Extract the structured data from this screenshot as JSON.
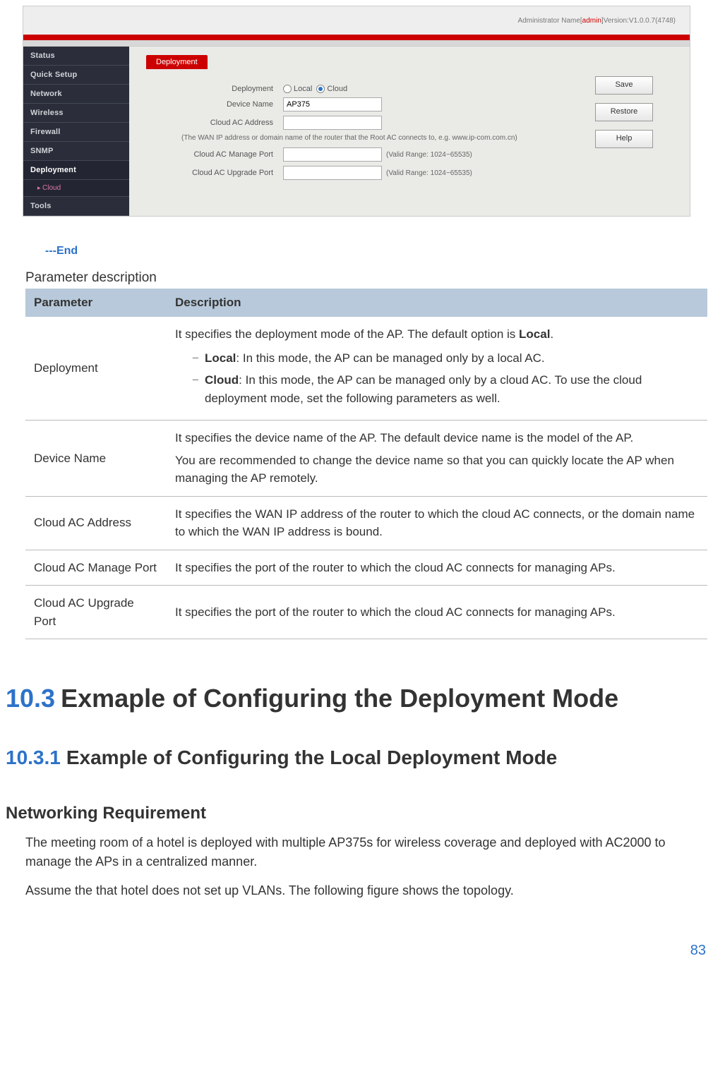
{
  "screenshot": {
    "topbar": {
      "admin_prefix": "Administrator Name[",
      "admin_user": "admin",
      "admin_suffix": "]Version:V1.0.0.7(4748)"
    },
    "sidebar": {
      "items": [
        "Status",
        "Quick Setup",
        "Network",
        "Wireless",
        "Firewall",
        "SNMP",
        "Deployment",
        "Tools"
      ],
      "sub_item": "Cloud"
    },
    "tab": "Deployment",
    "fields": {
      "deployment_label": "Deployment",
      "opt_local": "Local",
      "opt_cloud": "Cloud",
      "device_name_label": "Device Name",
      "device_name_value": "AP375",
      "cloud_addr_label": "Cloud AC Address",
      "note": "(The WAN IP address or domain name of the router that the Root AC connects to, e.g. www.ip-com.com.cn)",
      "manage_port_label": "Cloud AC Manage Port",
      "manage_hint": "(Valid Range: 1024~65535)",
      "upgrade_port_label": "Cloud AC Upgrade Port",
      "upgrade_hint": "(Valid Range: 1024~65535)"
    },
    "buttons": {
      "save": "Save",
      "restore": "Restore",
      "help": "Help"
    }
  },
  "end_marker": "---End",
  "param_section_title": "Parameter description",
  "table": {
    "head_param": "Parameter",
    "head_desc": "Description",
    "rows": [
      {
        "param": "Deployment",
        "desc_intro": "It specifies the deployment mode of the AP. The default option is ",
        "desc_intro_bold": "Local",
        "desc_intro_suffix": ".",
        "sub": [
          {
            "bold": "Local",
            "rest": ": In this mode, the AP can be managed only by a local AC."
          },
          {
            "bold": "Cloud",
            "rest": ": In this mode, the AP can be managed only by a cloud AC. To use the cloud deployment mode, set the following parameters as well."
          }
        ]
      },
      {
        "param": "Device Name",
        "desc_line1": "It specifies the device name of the AP. The default device name is the model of the AP.",
        "desc_line2": "You are recommended to change the device name so that you can quickly locate the AP when managing the AP remotely."
      },
      {
        "param": "Cloud AC Address",
        "desc": "It specifies the WAN IP address of the router to which the cloud AC connects, or the domain name to which the WAN IP address is bound."
      },
      {
        "param": "Cloud AC Manage Port",
        "desc": "It specifies the port of the router to which the cloud AC connects for managing APs."
      },
      {
        "param": "Cloud AC Upgrade Port",
        "desc": "It specifies the port of the router to which the cloud AC connects for managing APs."
      }
    ]
  },
  "section_103": {
    "num": "10.3",
    "title": "Exmaple of Configuring the Deployment Mode"
  },
  "section_1031": {
    "num": "10.3.1",
    "title": "Example of Configuring the Local Deployment Mode"
  },
  "networking_req": {
    "heading": "Networking Requirement",
    "p1": "The meeting room of a hotel is deployed with multiple AP375s for wireless coverage and deployed with AC2000 to manage the APs in a centralized manner.",
    "p2": "Assume the that hotel does not set up VLANs. The following figure shows the topology."
  },
  "page_number": "83"
}
